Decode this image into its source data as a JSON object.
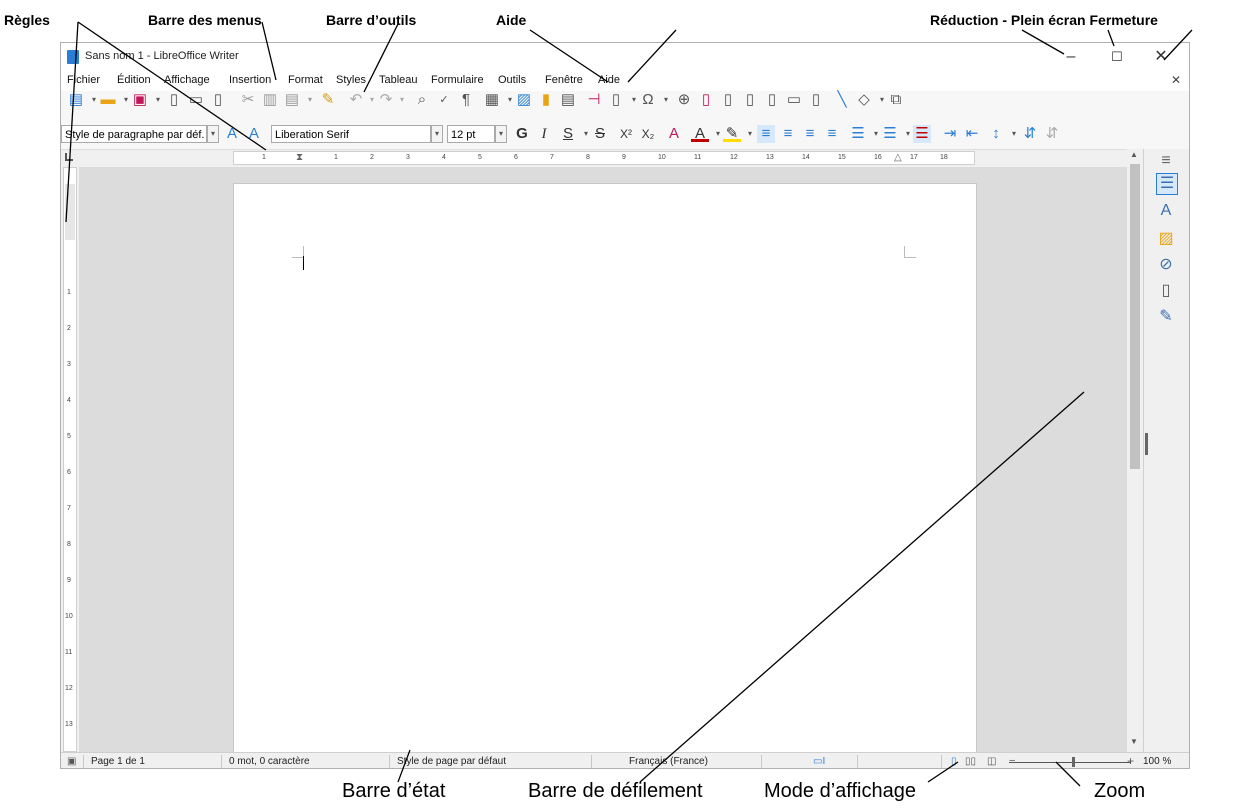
{
  "annotations": {
    "regles": "Règles",
    "barre_menus": "Barre des menus",
    "barre_outils": "Barre d’outils",
    "aide": "Aide",
    "reduction": "Réduction - Plein écran Fermeture",
    "barre_etat": "Barre d’état",
    "barre_defilement": "Barre de défilement",
    "mode_affichage": "Mode d’affichage",
    "zoom": "Zoom"
  },
  "window": {
    "title": "Sans nom 1 - LibreOffice Writer",
    "minimize_glyph": "–",
    "maximize_glyph": "☐",
    "close_glyph": "✕"
  },
  "menu": {
    "items": [
      "Fichier",
      "Édition",
      "Affichage",
      "Insertion",
      "Format",
      "Styles",
      "Tableau",
      "Formulaire",
      "Outils",
      "Fenêtre",
      "Aide"
    ],
    "close_glyph": "✕"
  },
  "formatting": {
    "paragraph_style": "Style de paragraphe par déf.",
    "font_name": "Liberation Serif",
    "font_size": "12 pt",
    "bold": "G",
    "italic": "I",
    "underline": "S",
    "strike": "S",
    "superscript": "X²",
    "subscript": "X₂"
  },
  "ruler": {
    "h_ticks": [
      "1",
      "1",
      "2",
      "3",
      "4",
      "5",
      "6",
      "7",
      "8",
      "9",
      "10",
      "11",
      "12",
      "13",
      "14",
      "15",
      "16",
      "17",
      "18"
    ],
    "v_ticks": [
      "1",
      "2",
      "3",
      "4",
      "5",
      "6",
      "7",
      "8",
      "9",
      "10",
      "11",
      "12",
      "13"
    ]
  },
  "status": {
    "page": "Page 1 de 1",
    "words": "0 mot, 0 caractère",
    "page_style": "Style de page par défaut",
    "language": "Français (France)",
    "zoom": "100 %"
  },
  "colors": {
    "accent": "#2a7fd4",
    "font_color": "#c00000",
    "highlight": "#ffdd00"
  }
}
